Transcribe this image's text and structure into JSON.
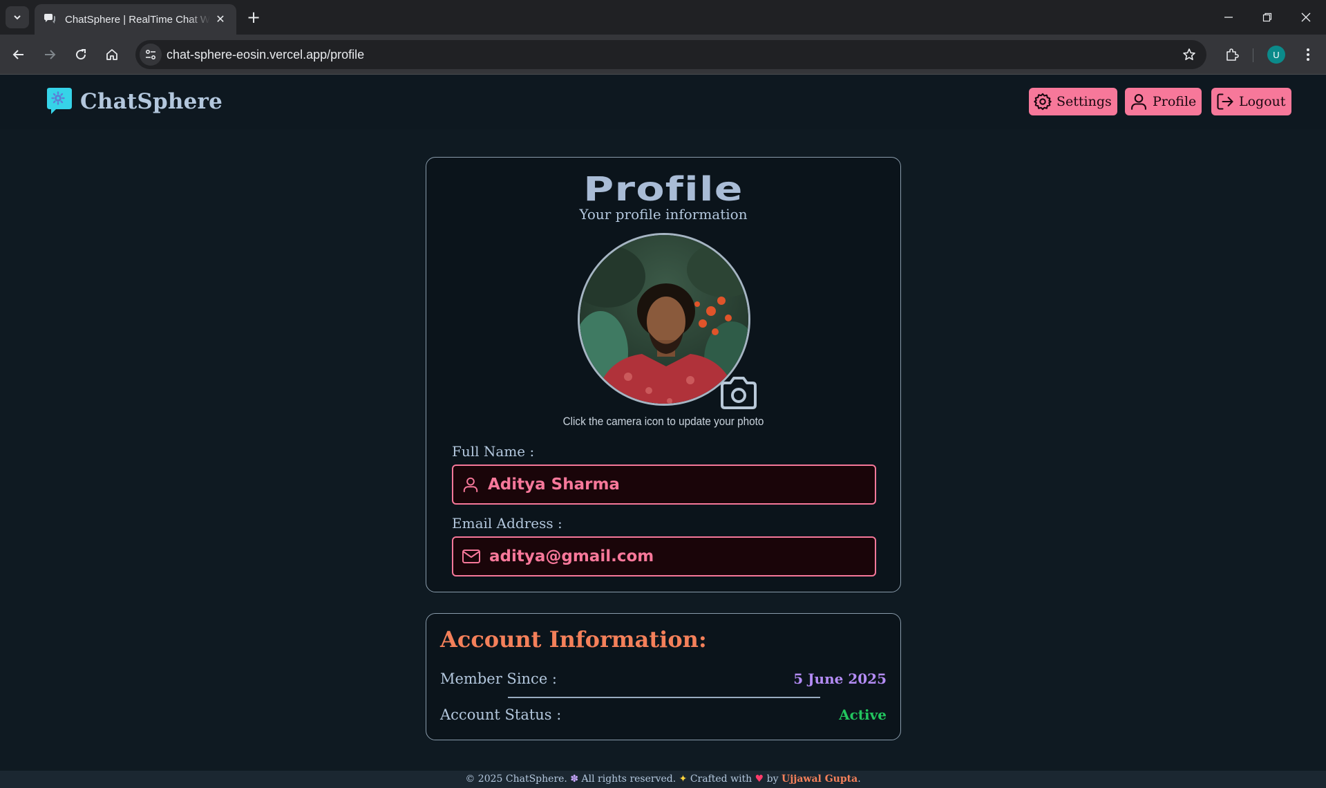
{
  "browser": {
    "tab_title": "ChatSphere | RealTime Chat With Friends",
    "url": "chat-sphere-eosin.vercel.app/profile",
    "profile_initial": "U"
  },
  "header": {
    "brand": "ChatSphere",
    "buttons": {
      "settings": "Settings",
      "profile": "Profile",
      "logout": "Logout"
    }
  },
  "profile": {
    "title": "Profile",
    "subtitle": "Your profile information",
    "photo_hint": "Click the camera icon to update your photo",
    "full_name_label": "Full Name :",
    "full_name": "Aditya Sharma",
    "email_label": "Email Address :",
    "email": "aditya@gmail.com"
  },
  "account": {
    "title": "Account Information:",
    "member_since_label": "Member Since :",
    "member_since": "5 June 2025",
    "status_label": "Account Status :",
    "status": "Active"
  },
  "footer": {
    "copyright": "© 2025 ChatSphere. ",
    "rights": " All rights reserved. ",
    "crafted": " Crafted with ",
    "by": " by ",
    "author": "Ujjawal Gupta",
    "end": "."
  },
  "colors": {
    "accent_pink": "#f7789a",
    "title_orange": "#f4805a",
    "date_purple": "#b48cf5",
    "status_green": "#22c55e"
  }
}
